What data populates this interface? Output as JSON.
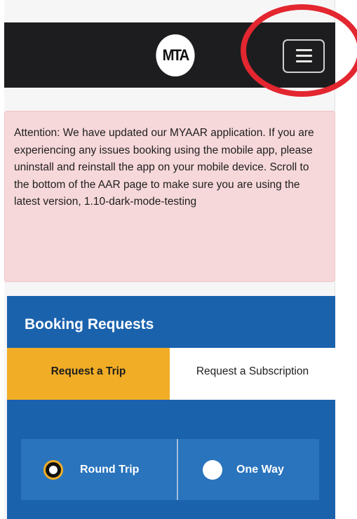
{
  "header": {
    "logo_text": "MTA",
    "menu_icon": "hamburger-menu-icon"
  },
  "alert": {
    "message": "Attention: We have updated our MYAAR application. If you are experiencing any issues booking using the mobile app, please uninstall and reinstall the app on your mobile device. Scroll to the bottom of the AAR page to make sure you are using the latest version, 1.10-dark-mode-testing"
  },
  "booking": {
    "title": "Booking Requests",
    "tabs": [
      {
        "label": "Request a Trip",
        "active": true
      },
      {
        "label": "Request a Subscription",
        "active": false
      }
    ],
    "trip_type": {
      "options": [
        {
          "label": "Round Trip",
          "selected": true
        },
        {
          "label": "One Way",
          "selected": false
        }
      ]
    }
  },
  "colors": {
    "navbar": "#1d1d1f",
    "alert_bg": "#f7d8da",
    "booking_bg": "#1b62ad",
    "tab_active": "#f1ad25",
    "highlight_ring": "#e3262f"
  }
}
